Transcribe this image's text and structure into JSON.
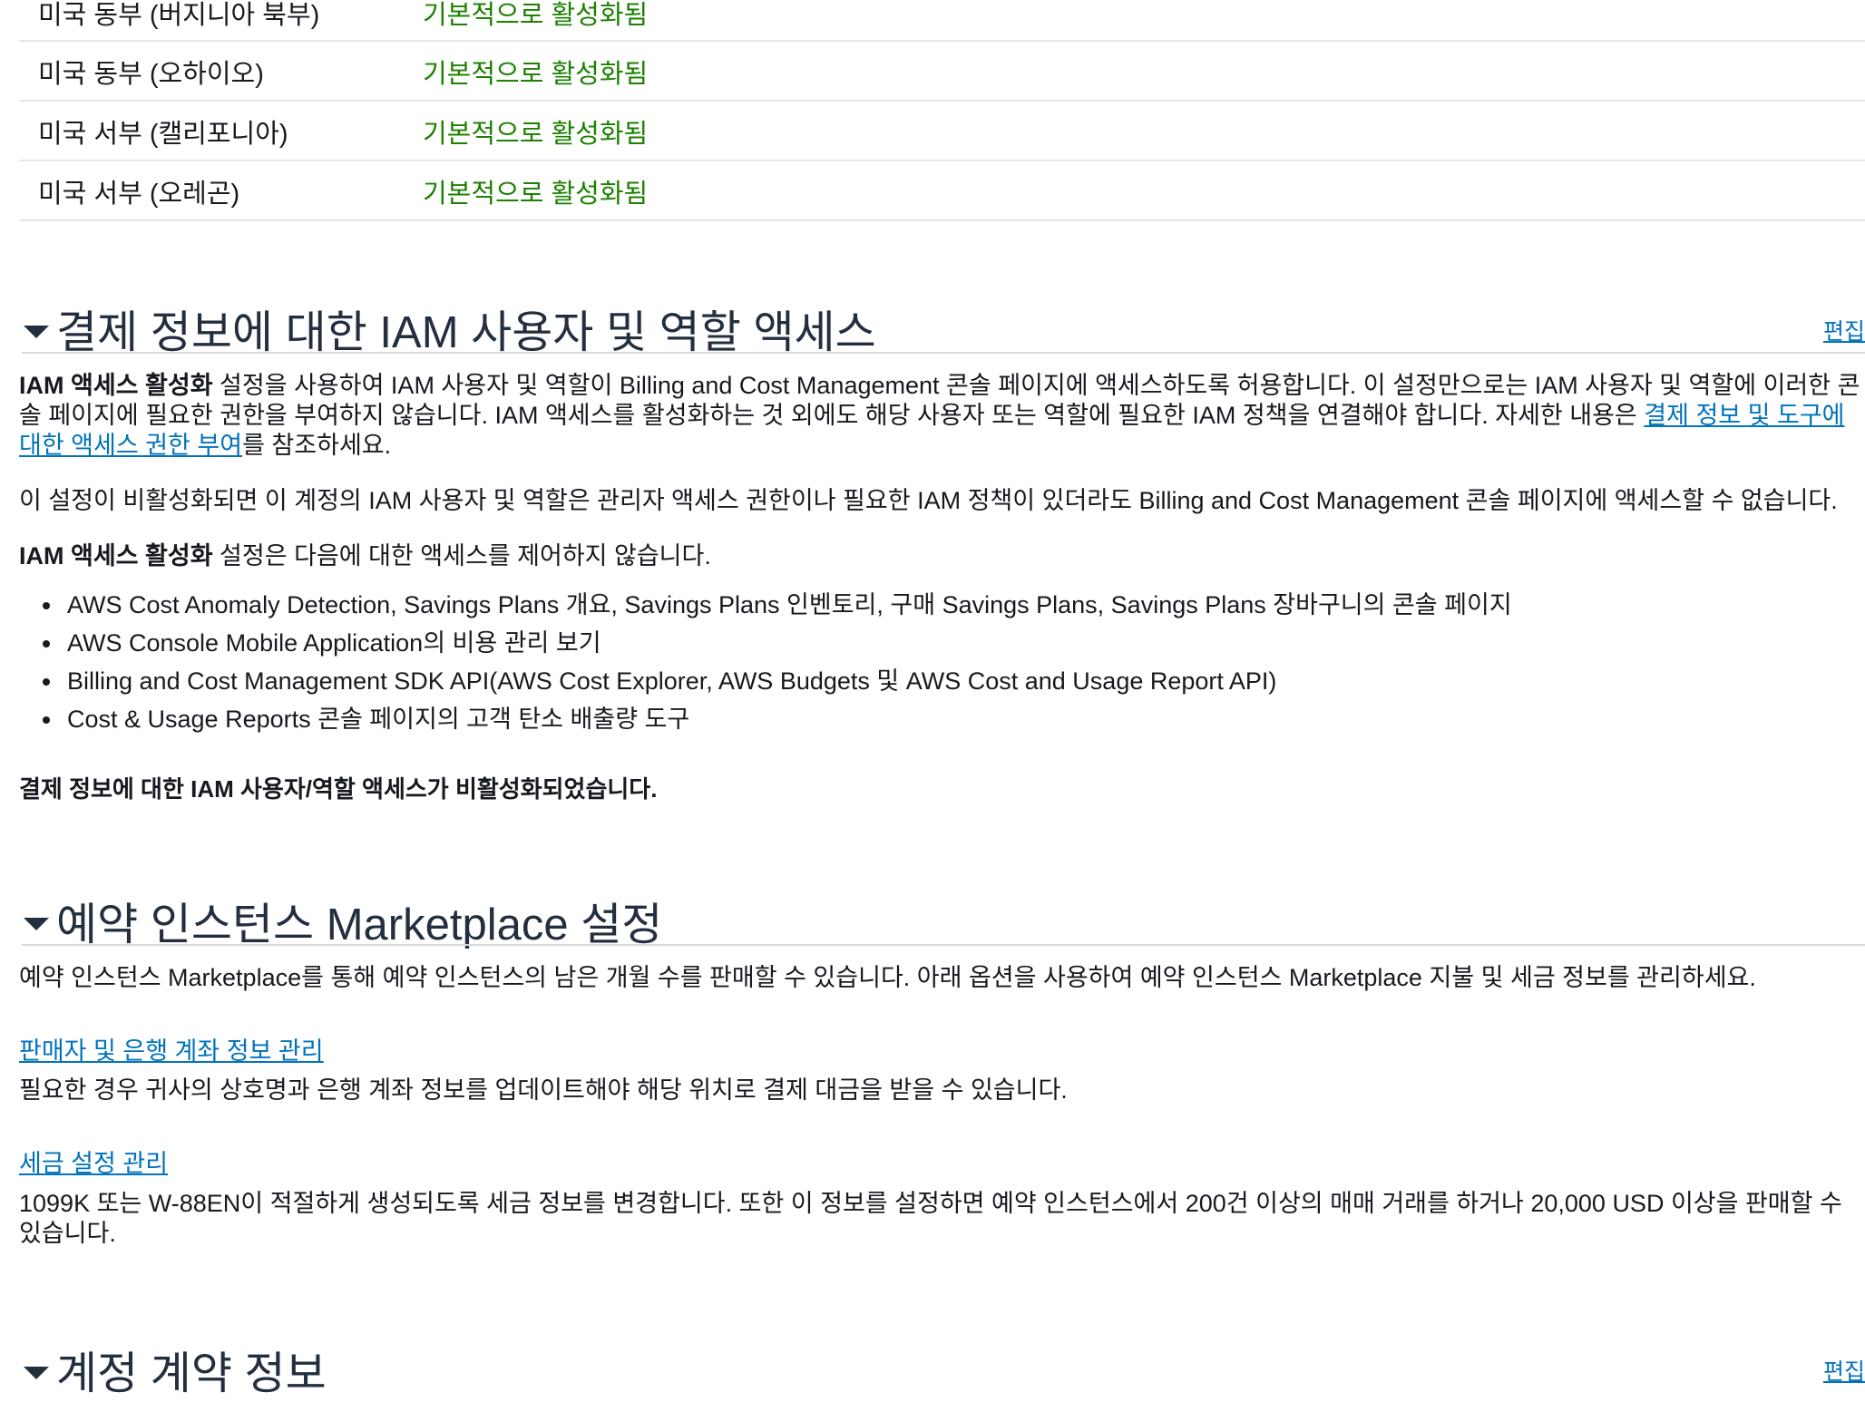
{
  "regions_table": {
    "rows": [
      {
        "region": "미국 동부 (버지니아 북부)",
        "status": "기본적으로 활성화됨"
      },
      {
        "region": "미국 동부 (오하이오)",
        "status": "기본적으로 활성화됨"
      },
      {
        "region": "미국 서부 (캘리포니아)",
        "status": "기본적으로 활성화됨"
      },
      {
        "region": "미국 서부 (오레곤)",
        "status": "기본적으로 활성화됨"
      }
    ]
  },
  "iam_section": {
    "title": "결제 정보에 대한 IAM 사용자 및 역할 액세스",
    "edit_label": "편집",
    "p1_bold": "IAM 액세스 활성화",
    "p1_text": " 설정을 사용하여 IAM 사용자 및 역할이 Billing and Cost Management 콘솔 페이지에 액세스하도록 허용합니다. 이 설정만으로는 IAM 사용자 및 역할에 이러한 콘솔 페이지에 필요한 권한을 부여하지 않습니다. IAM 액세스를 활성화하는 것 외에도 해당 사용자 또는 역할에 필요한 IAM 정책을 연결해야 합니다. 자세한 내용은 ",
    "p1_link": "결제 정보 및 도구에 대한 액세스 권한 부여",
    "p1_tail": "를 참조하세요.",
    "p2": "이 설정이 비활성화되면 이 계정의 IAM 사용자 및 역할은 관리자 액세스 권한이나 필요한 IAM 정책이 있더라도 Billing and Cost Management 콘솔 페이지에 액세스할 수 없습니다.",
    "p3_bold": "IAM 액세스 활성화",
    "p3_text": " 설정은 다음에 대한 액세스를 제어하지 않습니다.",
    "bullets": [
      "AWS Cost Anomaly Detection, Savings Plans 개요, Savings Plans 인벤토리, 구매 Savings Plans, Savings Plans 장바구니의 콘솔 페이지",
      "AWS Console Mobile Application의 비용 관리 보기",
      "Billing and Cost Management SDK API(AWS Cost Explorer, AWS Budgets 및 AWS Cost and Usage Report API)",
      "Cost & Usage Reports 콘솔 페이지의 고객 탄소 배출량 도구"
    ],
    "status_line": "결제 정보에 대한 IAM 사용자/역할 액세스가 비활성화되었습니다."
  },
  "ri_section": {
    "title": "예약 인스턴스 Marketplace 설정",
    "intro": "예약 인스턴스 Marketplace를 통해 예약 인스턴스의 남은 개월 수를 판매할 수 있습니다. 아래 옵션을 사용하여 예약 인스턴스 Marketplace 지불 및 세금 정보를 관리하세요.",
    "seller_link": "판매자 및 은행 계좌 정보 관리",
    "seller_desc": "필요한 경우 귀사의 상호명과 은행 계좌 정보를 업데이트해야 해당 위치로 결제 대금을 받을 수 있습니다.",
    "tax_link": "세금 설정 관리",
    "tax_desc": "1099K 또는 W-88EN이 적절하게 생성되도록 세금 정보를 변경합니다. 또한 이 정보를 설정하면 예약 인스턴스에서 200건 이상의 매매 거래를 하거나 20,000 USD 이상을 판매할 수 있습니다."
  },
  "account_section": {
    "title": "계정 계약 정보",
    "edit_label": "편집"
  }
}
